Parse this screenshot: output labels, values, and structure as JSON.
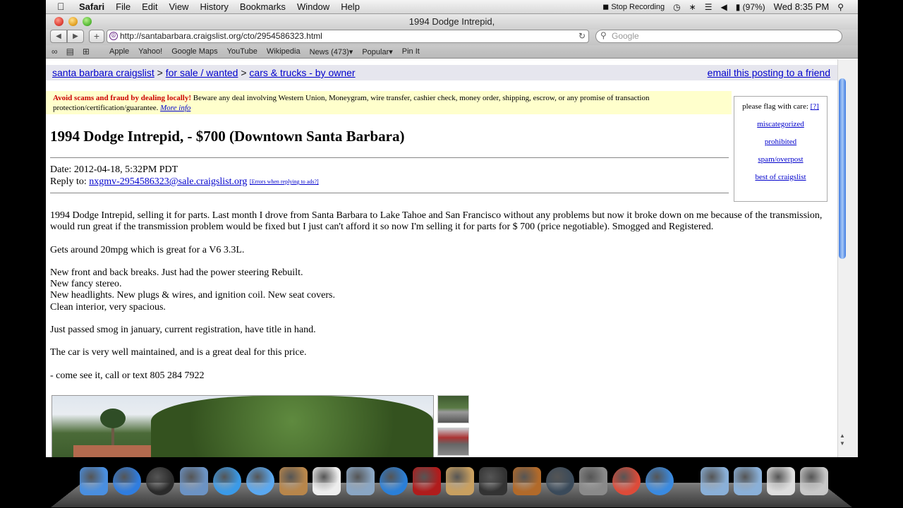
{
  "menubar": {
    "apple": "",
    "items": [
      "Safari",
      "File",
      "Edit",
      "View",
      "History",
      "Bookmarks",
      "Window",
      "Help"
    ],
    "stop_recording": "Stop Recording",
    "battery": "(97%)",
    "clock": "Wed 8:35 PM"
  },
  "window": {
    "title": "1994 Dodge Intrepid,",
    "url": "http://santabarbara.craigslist.org/cto/2954586323.html",
    "search_placeholder": "Google"
  },
  "bookmarks": [
    "Apple",
    "Yahoo!",
    "Google Maps",
    "YouTube",
    "Wikipedia",
    "News (473)▾",
    "Popular▾",
    "Pin It"
  ],
  "breadcrumb": {
    "site": "santa barbara craigslist",
    "section": "for sale / wanted",
    "category": "cars & trucks - by owner",
    "sep": ">",
    "email_link": "email this posting to a friend"
  },
  "warning": {
    "strong": "Avoid scams and fraud by dealing locally!",
    "text": " Beware any deal involving Western Union, Moneygram, wire transfer, cashier check, money order, shipping, escrow, or any promise of transaction protection/certification/guarantee. ",
    "more": "More info"
  },
  "flag": {
    "title": "please flag with care:",
    "help": "[?]",
    "links": [
      "miscategorized",
      "prohibited",
      "spam/overpost",
      "best of craigslist"
    ]
  },
  "posting": {
    "title": "1994 Dodge Intrepid, - $700 (Downtown Santa Barbara)",
    "date": "Date: 2012-04-18, 5:32PM PDT",
    "reply_label": "Reply to: ",
    "reply_email": "nxgmv-2954586323@sale.craigslist.org",
    "errors_link": "[Errors when replying to ads?]",
    "paragraphs": [
      "1994 Dodge Intrepid, selling it for parts. Last month I drove from Santa Barbara to Lake Tahoe and San Francisco without any problems but now it broke down on me because of the transmission, would run great if the transmission problem would be fixed but I just can't afford it so now I'm selling it for parts for $ 700 (price negotiable). Smogged and Registered.",
      "Gets around 20mpg which is great for a V6 3.3L.",
      "New front and back breaks. Just had the power steering Rebuilt.\nNew fancy stereo.\nNew headlights. New plugs & wires, and ignition coil. New seat covers.\nClean interior, very spacious.",
      "Just passed smog in january, current registration, have title in hand.",
      "The car is very well maintained, and is a great deal for this price.",
      "- come see it, call or text 805 284 7922"
    ]
  },
  "dock": [
    {
      "name": "finder-icon",
      "color": "#4a8fe0"
    },
    {
      "name": "app-store-icon",
      "color": "#2f7de0"
    },
    {
      "name": "dashboard-icon",
      "color": "#2a2a2a"
    },
    {
      "name": "mail-icon",
      "color": "#6c93c4"
    },
    {
      "name": "safari-icon",
      "color": "#3a9ae8"
    },
    {
      "name": "ichat-icon",
      "color": "#5aa8f0"
    },
    {
      "name": "address-book-icon",
      "color": "#b8864b"
    },
    {
      "name": "ical-icon",
      "color": "#eeeeee"
    },
    {
      "name": "iphoto-icon",
      "color": "#8aa6c4"
    },
    {
      "name": "itunes-icon",
      "color": "#2a7fd8"
    },
    {
      "name": "photo-booth-icon",
      "color": "#b01c1c"
    },
    {
      "name": "image-capture-icon",
      "color": "#c9a060"
    },
    {
      "name": "imovie-icon",
      "color": "#333333"
    },
    {
      "name": "garageband-icon",
      "color": "#b26a2a"
    },
    {
      "name": "time-machine-icon",
      "color": "#3a4a5a"
    },
    {
      "name": "system-preferences-icon",
      "color": "#8a8a8a"
    },
    {
      "name": "chrome-icon",
      "color": "#dd4b39"
    },
    {
      "name": "quicktime-icon",
      "color": "#3a8ae0"
    },
    {
      "name": "applications-folder-icon",
      "color": "#8ab0d8"
    },
    {
      "name": "documents-folder-icon",
      "color": "#8ab0d8"
    },
    {
      "name": "downloads-stack-icon",
      "color": "#dddddd"
    },
    {
      "name": "trash-icon",
      "color": "#c8c8c8"
    }
  ]
}
